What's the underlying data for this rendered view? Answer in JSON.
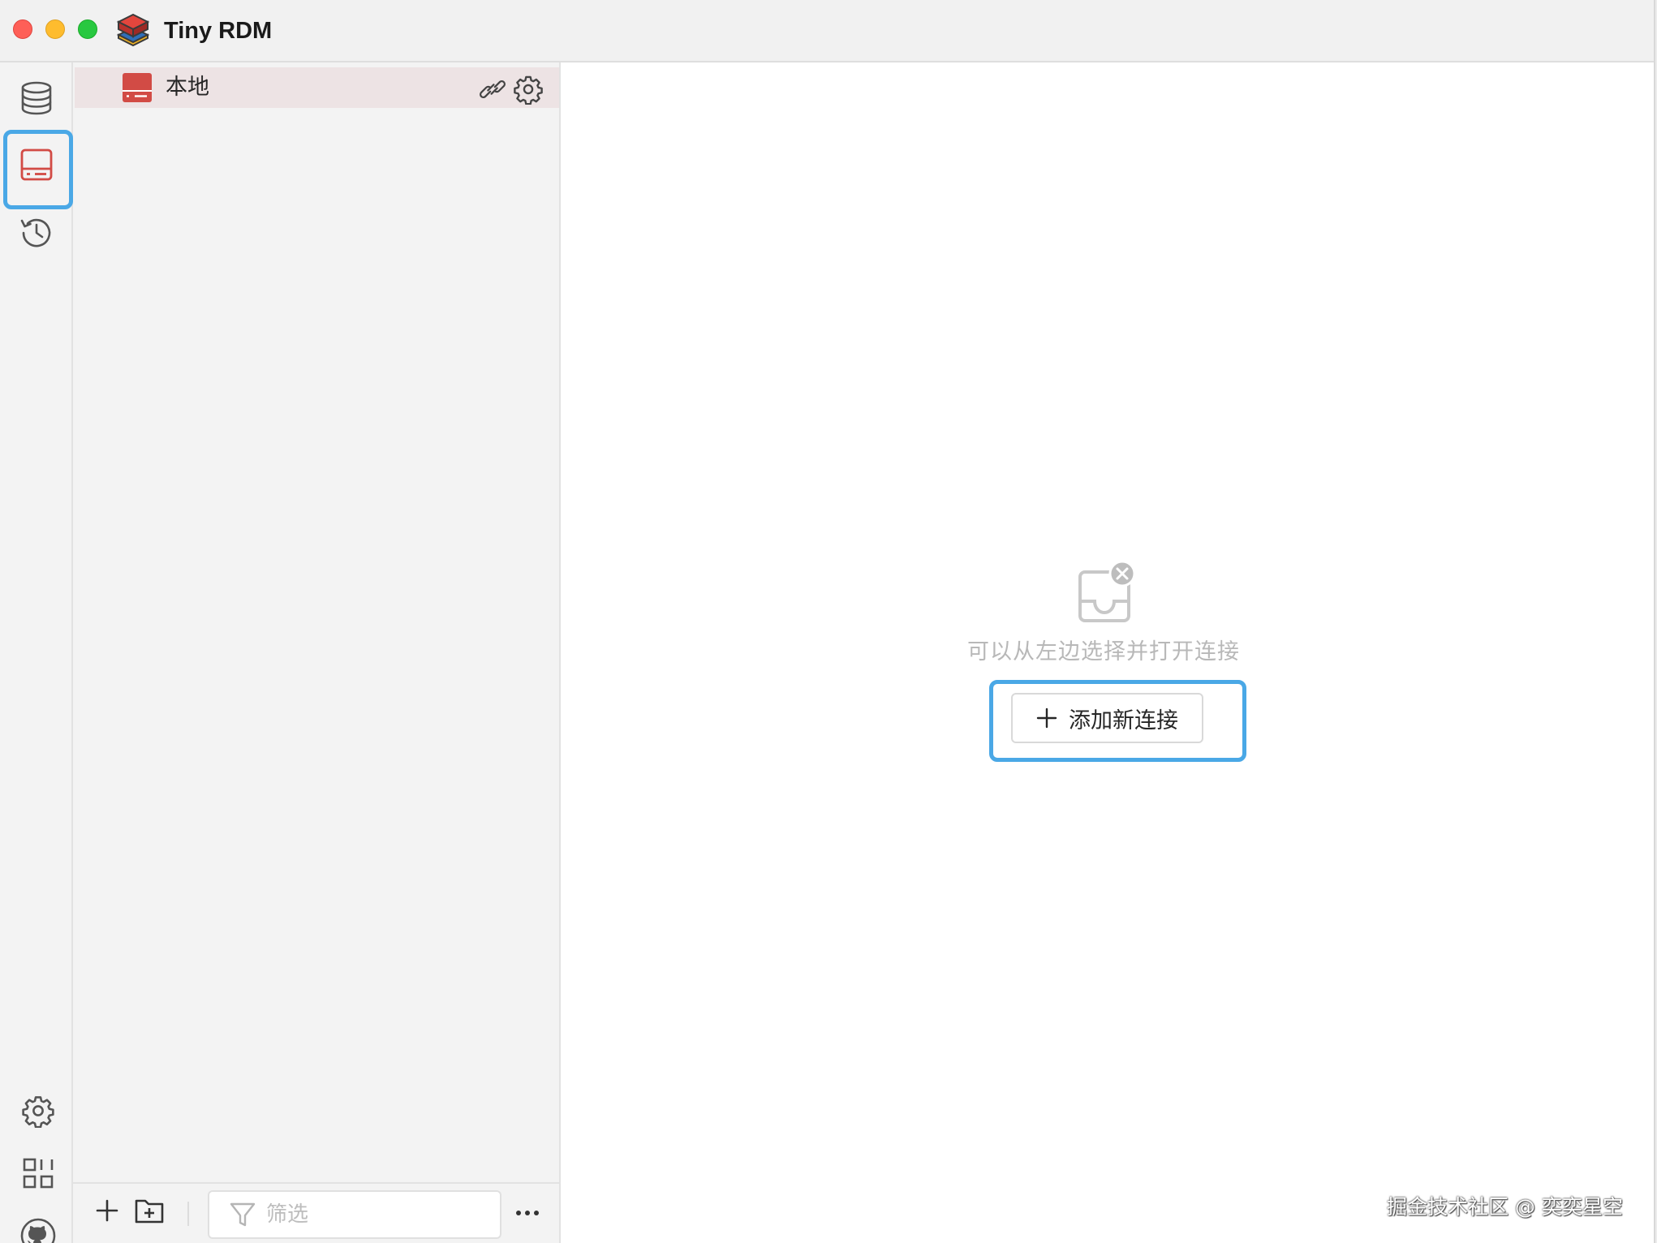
{
  "window": {
    "title": "Tiny RDM"
  },
  "rail": {
    "items": [
      {
        "icon": "database-icon",
        "name": "servers"
      },
      {
        "icon": "terminal-icon",
        "name": "connections",
        "active": true
      },
      {
        "icon": "history-icon",
        "name": "history"
      }
    ],
    "bottom_items": [
      {
        "icon": "gear-icon",
        "name": "settings"
      },
      {
        "icon": "apps-icon",
        "name": "apps"
      },
      {
        "icon": "github-icon",
        "name": "github"
      }
    ]
  },
  "connections": {
    "items": [
      {
        "label": "本地",
        "icon": "database-server-icon",
        "color": "#d24b45"
      }
    ]
  },
  "footer": {
    "filter_placeholder": "筛选"
  },
  "main": {
    "empty_message": "可以从左边选择并打开连接",
    "add_button_label": "添加新连接"
  },
  "watermark": "掘金技术社区 @ 奕奕星空",
  "colors": {
    "accent": "#4aa8e6",
    "server_red": "#d24b45",
    "selected_row": "#ede3e4"
  }
}
